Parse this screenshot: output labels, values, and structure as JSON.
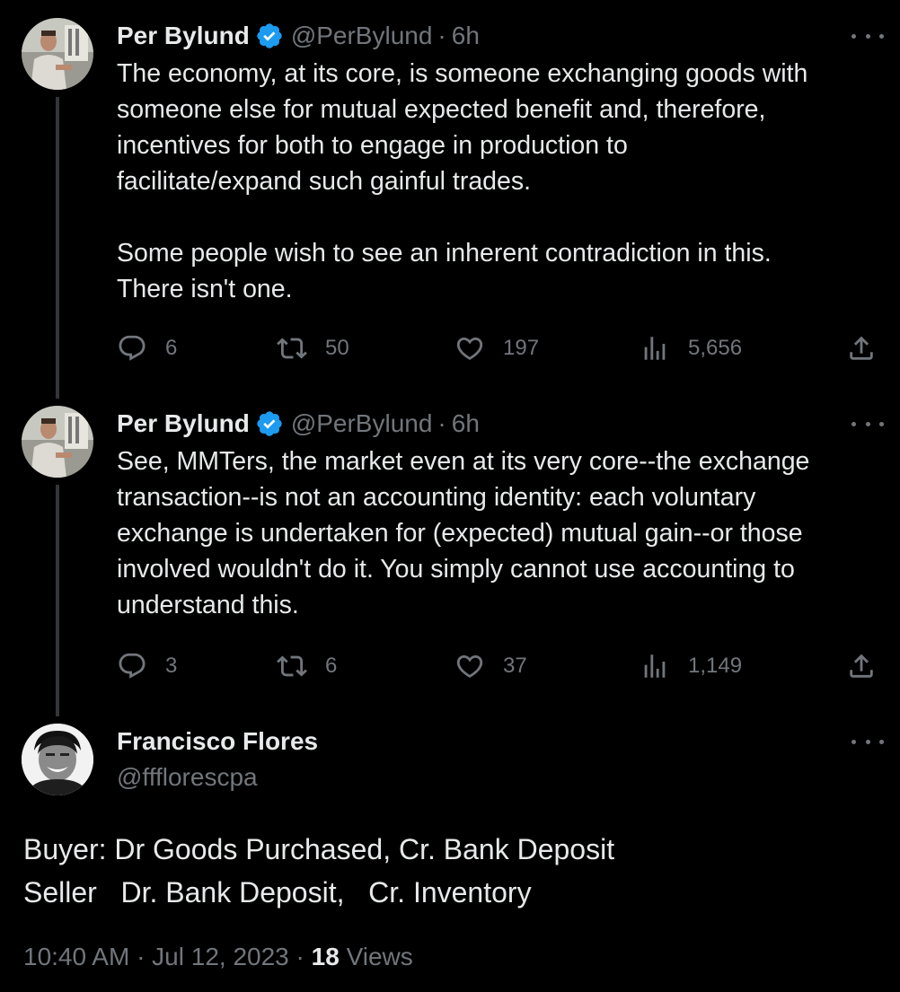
{
  "tweets": [
    {
      "name": "Per Bylund",
      "handle": "@PerBylund",
      "separator": "·",
      "time": "6h",
      "text": "The economy, at its core, is someone exchanging goods with\nsomeone else for mutual expected benefit and, therefore,\nincentives for both to engage in production to\nfacilitate/expand such gainful trades.\n\nSome people wish to see an inherent contradiction in this.\nThere isn't one.",
      "replies": "6",
      "reposts": "50",
      "likes": "197",
      "views": "5,656"
    },
    {
      "name": "Per Bylund",
      "handle": "@PerBylund",
      "separator": "·",
      "time": "6h",
      "text": "See, MMTers, the market even at its very core--the exchange\ntransaction--is not an accounting identity: each voluntary\nexchange is undertaken for (expected) mutual gain--or those\ninvolved wouldn't do it. You simply cannot use accounting to\nunderstand this.",
      "replies": "3",
      "reposts": "6",
      "likes": "37",
      "views": "1,149"
    }
  ],
  "reply": {
    "name": "Francisco Flores",
    "handle": "@ffflorescpa",
    "line1": "Buyer: Dr Goods Purchased, Cr. Bank Deposit",
    "line2": "Seller   Dr. Bank Deposit,   Cr. Inventory",
    "timestamp": "10:40 AM · Jul 12, 2023 ·",
    "views_count": "18",
    "views_label": "Views"
  },
  "colors": {
    "background": "#000000",
    "text": "#e7e9ea",
    "muted": "#71767b",
    "verified": "#1d9bf0",
    "thread_line": "#333639"
  },
  "icons": [
    "verified-badge-icon",
    "more-icon",
    "reply-icon",
    "repost-icon",
    "like-icon",
    "views-icon",
    "share-icon"
  ]
}
